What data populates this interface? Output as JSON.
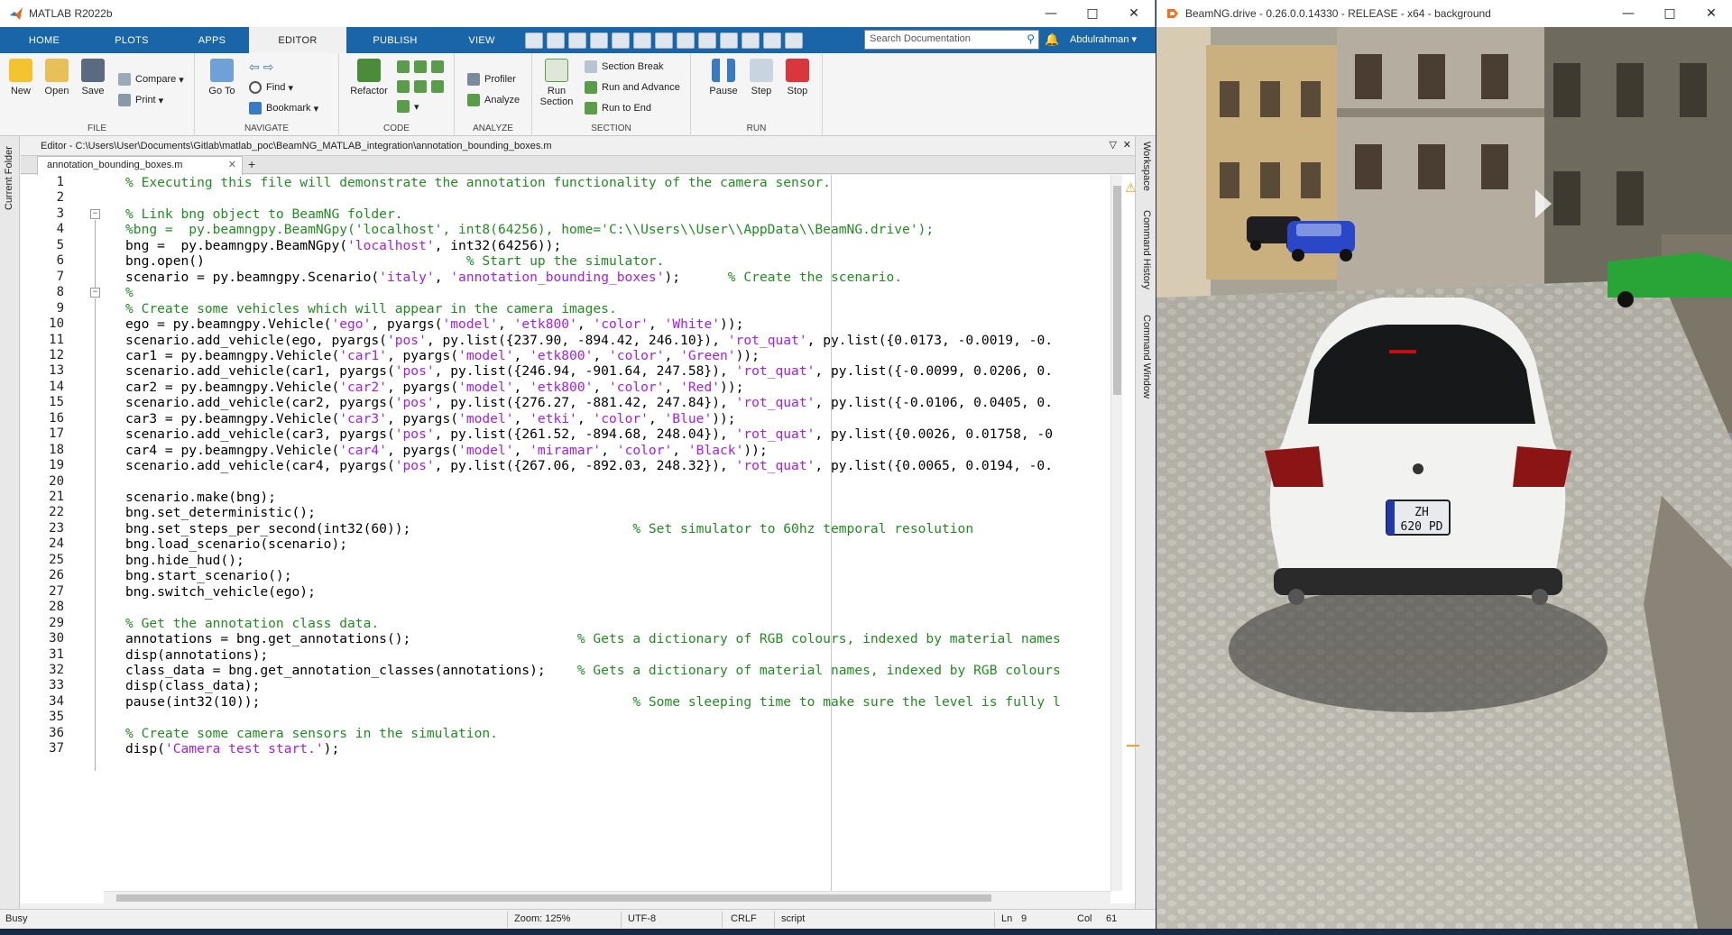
{
  "matlab": {
    "title": "MATLAB R2022b",
    "tabs": [
      "HOME",
      "PLOTS",
      "APPS",
      "EDITOR",
      "PUBLISH",
      "VIEW"
    ],
    "active_tab": "EDITOR",
    "search_placeholder": "Search Documentation",
    "user": "Abdulrahman",
    "ribbon": {
      "file": {
        "label": "FILE",
        "new": "New",
        "open": "Open",
        "save": "Save",
        "compare": "Compare",
        "print": "Print"
      },
      "navigate": {
        "label": "NAVIGATE",
        "goto": "Go To",
        "find": "Find",
        "bookmark": "Bookmark"
      },
      "code": {
        "label": "CODE",
        "refactor": "Refactor"
      },
      "analyze": {
        "label": "ANALYZE",
        "profiler": "Profiler",
        "analyze": "Analyze"
      },
      "section": {
        "label": "SECTION",
        "run_section": "Run Section",
        "section_break": "Section Break",
        "run_and_advance": "Run and Advance",
        "run_to_end": "Run to End"
      },
      "run": {
        "label": "RUN",
        "pause": "Pause",
        "step": "Step",
        "stop": "Stop"
      }
    },
    "left_panel": "Current Folder",
    "right_panels": [
      "Workspace",
      "Command History",
      "Command Window"
    ],
    "editor_path": "Editor - C:\\Users\\User\\Documents\\Gitlab\\matlab_poc\\BeamNG_MATLAB_integration\\annotation_bounding_boxes.m",
    "file_tab": "annotation_bounding_boxes.m",
    "code_lines": [
      [
        [
          "c",
          "% Executing this file will demonstrate the annotation functionality of the camera sensor."
        ]
      ],
      [],
      [
        [
          "c",
          "% Link bng object to BeamNG folder."
        ]
      ],
      [
        [
          "c",
          "%bng =  py.beamngpy.BeamNGpy('localhost', int8(64256), home='C:\\\\Users\\\\User\\\\AppData\\\\BeamNG.drive');"
        ]
      ],
      [
        [
          "n",
          "bng =  py.beamngpy.BeamNGpy("
        ],
        [
          "s",
          "'localhost'"
        ],
        [
          "n",
          ", int32(64256));"
        ]
      ],
      [
        [
          "n",
          "bng.open()                                 "
        ],
        [
          "c",
          "% Start up the simulator."
        ]
      ],
      [
        [
          "n",
          "scenario = py.beamngpy.Scenario("
        ],
        [
          "s",
          "'italy'"
        ],
        [
          "n",
          ", "
        ],
        [
          "s",
          "'annotation_bounding_boxes'"
        ],
        [
          "n",
          ");      "
        ],
        [
          "c",
          "% Create the scenario."
        ]
      ],
      [
        [
          "c",
          "%"
        ]
      ],
      [
        [
          "c",
          "% Create some vehicles which will appear in the camera images."
        ]
      ],
      [
        [
          "n",
          "ego = py.beamngpy.Vehicle("
        ],
        [
          "s",
          "'ego'"
        ],
        [
          "n",
          ", pyargs("
        ],
        [
          "s",
          "'model'"
        ],
        [
          "n",
          ", "
        ],
        [
          "s",
          "'etk800'"
        ],
        [
          "n",
          ", "
        ],
        [
          "s",
          "'color'"
        ],
        [
          "n",
          ", "
        ],
        [
          "s",
          "'White'"
        ],
        [
          "n",
          "));"
        ]
      ],
      [
        [
          "n",
          "scenario.add_vehicle(ego, pyargs("
        ],
        [
          "s",
          "'pos'"
        ],
        [
          "n",
          ", py.list({237.90, -894.42, 246.10}), "
        ],
        [
          "s",
          "'rot_quat'"
        ],
        [
          "n",
          ", py.list({0.0173, -0.0019, -0."
        ]
      ],
      [
        [
          "n",
          "car1 = py.beamngpy.Vehicle("
        ],
        [
          "s",
          "'car1'"
        ],
        [
          "n",
          ", pyargs("
        ],
        [
          "s",
          "'model'"
        ],
        [
          "n",
          ", "
        ],
        [
          "s",
          "'etk800'"
        ],
        [
          "n",
          ", "
        ],
        [
          "s",
          "'color'"
        ],
        [
          "n",
          ", "
        ],
        [
          "s",
          "'Green'"
        ],
        [
          "n",
          "));"
        ]
      ],
      [
        [
          "n",
          "scenario.add_vehicle(car1, pyargs("
        ],
        [
          "s",
          "'pos'"
        ],
        [
          "n",
          ", py.list({246.94, -901.64, 247.58}), "
        ],
        [
          "s",
          "'rot_quat'"
        ],
        [
          "n",
          ", py.list({-0.0099, 0.0206, 0."
        ]
      ],
      [
        [
          "n",
          "car2 = py.beamngpy.Vehicle("
        ],
        [
          "s",
          "'car2'"
        ],
        [
          "n",
          ", pyargs("
        ],
        [
          "s",
          "'model'"
        ],
        [
          "n",
          ", "
        ],
        [
          "s",
          "'etk800'"
        ],
        [
          "n",
          ", "
        ],
        [
          "s",
          "'color'"
        ],
        [
          "n",
          ", "
        ],
        [
          "s",
          "'Red'"
        ],
        [
          "n",
          "));"
        ]
      ],
      [
        [
          "n",
          "scenario.add_vehicle(car2, pyargs("
        ],
        [
          "s",
          "'pos'"
        ],
        [
          "n",
          ", py.list({276.27, -881.42, 247.84}), "
        ],
        [
          "s",
          "'rot_quat'"
        ],
        [
          "n",
          ", py.list({-0.0106, 0.0405, 0."
        ]
      ],
      [
        [
          "n",
          "car3 = py.beamngpy.Vehicle("
        ],
        [
          "s",
          "'car3'"
        ],
        [
          "n",
          ", pyargs("
        ],
        [
          "s",
          "'model'"
        ],
        [
          "n",
          ", "
        ],
        [
          "s",
          "'etki'"
        ],
        [
          "n",
          ", "
        ],
        [
          "s",
          "'color'"
        ],
        [
          "n",
          ", "
        ],
        [
          "s",
          "'Blue'"
        ],
        [
          "n",
          "));"
        ]
      ],
      [
        [
          "n",
          "scenario.add_vehicle(car3, pyargs("
        ],
        [
          "s",
          "'pos'"
        ],
        [
          "n",
          ", py.list({261.52, -894.68, 248.04}), "
        ],
        [
          "s",
          "'rot_quat'"
        ],
        [
          "n",
          ", py.list({0.0026, 0.01758, -0"
        ]
      ],
      [
        [
          "n",
          "car4 = py.beamngpy.Vehicle("
        ],
        [
          "s",
          "'car4'"
        ],
        [
          "n",
          ", pyargs("
        ],
        [
          "s",
          "'model'"
        ],
        [
          "n",
          ", "
        ],
        [
          "s",
          "'miramar'"
        ],
        [
          "n",
          ", "
        ],
        [
          "s",
          "'color'"
        ],
        [
          "n",
          ", "
        ],
        [
          "s",
          "'Black'"
        ],
        [
          "n",
          "));"
        ]
      ],
      [
        [
          "n",
          "scenario.add_vehicle(car4, pyargs("
        ],
        [
          "s",
          "'pos'"
        ],
        [
          "n",
          ", py.list({267.06, -892.03, 248.32}), "
        ],
        [
          "s",
          "'rot_quat'"
        ],
        [
          "n",
          ", py.list({0.0065, 0.0194, -0."
        ]
      ],
      [],
      [
        [
          "n",
          "scenario.make(bng);"
        ]
      ],
      [
        [
          "n",
          "bng.set_deterministic();"
        ]
      ],
      [
        [
          "n",
          "bng.set_steps_per_second(int32(60));                            "
        ],
        [
          "c",
          "% Set simulator to 60hz temporal resolution"
        ]
      ],
      [
        [
          "n",
          "bng.load_scenario(scenario);"
        ]
      ],
      [
        [
          "n",
          "bng.hide_hud();"
        ]
      ],
      [
        [
          "n",
          "bng.start_scenario();"
        ]
      ],
      [
        [
          "n",
          "bng.switch_vehicle(ego);"
        ]
      ],
      [],
      [
        [
          "c",
          "% Get the annotation class data."
        ]
      ],
      [
        [
          "n",
          "annotations = bng.get_annotations();                     "
        ],
        [
          "c",
          "% Gets a dictionary of RGB colours, indexed by material names"
        ]
      ],
      [
        [
          "n",
          "disp(annotations);"
        ]
      ],
      [
        [
          "n",
          "class_data = bng.get_annotation_classes(annotations);    "
        ],
        [
          "c",
          "% Gets a dictionary of material names, indexed by RGB colours"
        ]
      ],
      [
        [
          "n",
          "disp(class_data);"
        ]
      ],
      [
        [
          "n",
          "pause(int32(10));                                               "
        ],
        [
          "c",
          "% Some sleeping time to make sure the level is fully l"
        ]
      ],
      [],
      [
        [
          "c",
          "% Create some camera sensors in the simulation."
        ]
      ],
      [
        [
          "n",
          "disp("
        ],
        [
          "s",
          "'Camera test start.'"
        ],
        [
          "n",
          ");"
        ]
      ]
    ],
    "status": {
      "state": "Busy",
      "zoom": "Zoom: 125%",
      "encoding": "UTF-8",
      "eol": "CRLF",
      "type": "script",
      "ln_label": "Ln",
      "ln": "9",
      "col_label": "Col",
      "col": "61"
    }
  },
  "beamng": {
    "title": "BeamNG.drive - 0.26.0.0.14330 - RELEASE - x64 - background",
    "plate_line1": "ZH",
    "plate_line2": "620 PD"
  },
  "colors": {
    "matlab_blue": "#1a65a8",
    "comment": "#228b22",
    "string": "#a020f0"
  }
}
